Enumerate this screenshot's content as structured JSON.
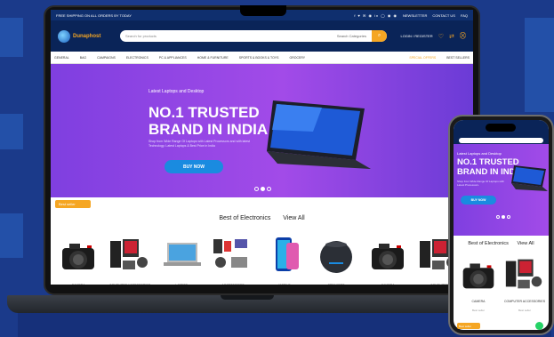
{
  "topbar": {
    "announcement": "FREE SHIPPING ON ALL ORDERS BY TODAY",
    "social": "f ♥ ✉ ◉ in ◯ ◉ ◉",
    "newsletter": "NEWSLETTER",
    "contact": "CONTACT US",
    "faq": "FAQ"
  },
  "header": {
    "logo_text": "Dunaphost",
    "search_placeholder": "Search for products",
    "search_category": "Search Categories",
    "account_label": "LOGIN / REGISTER"
  },
  "nav": {
    "items": [
      "GENERAL",
      "BAG",
      "CAMPAIGNS",
      "ELECTRONICS",
      "PC & APPLIANCES",
      "HOME & FURNITURE",
      "SPORTS & BOOKS & TOYS",
      "GROCERY"
    ],
    "highlight": "SPECIAL OFFERS",
    "last": "BEST SELLERS"
  },
  "hero": {
    "kicker": "Latest Laptops and Desktop",
    "title": "NO.1 TRUSTED BRAND IN INDIA",
    "description": "Shop from Wide Range Of Laptops with Latest Processors and with latest Technology. Latest Laptops & Best Price in India",
    "cta": "BUY NOW"
  },
  "products": {
    "badge": "Best seller",
    "section_title": "Best of Electronics",
    "view_all": "View All",
    "items": [
      {
        "label": "CAMERA",
        "icon": "camera-icon"
      },
      {
        "label": "COMPUTER ACCESSORIES",
        "icon": "accessories-icon"
      },
      {
        "label": "LAPTOP",
        "icon": "laptop-icon"
      },
      {
        "label": "ACCESSORIES",
        "icon": "gadgets-icon"
      },
      {
        "label": "MOBILE",
        "icon": "phone-icon"
      },
      {
        "label": "SPEAKERS",
        "icon": "speaker-icon"
      },
      {
        "label": "CAMERA",
        "icon": "camera-icon"
      },
      {
        "label": "COMPUTER",
        "icon": "accessories-icon"
      }
    ]
  },
  "phone": {
    "kicker": "Latest Laptops and Desktop",
    "title": "NO.1 TRUSTED BRAND IN INDIA",
    "description": "Shop from Wide Range Of Laptops with Latest Processors.",
    "cta": "BUY NOW",
    "section_title": "Best of Electronics",
    "view_all": "View All",
    "items": [
      {
        "label": "CAMERA",
        "sub": "Best seller"
      },
      {
        "label": "COMPUTER ACCESSORIES",
        "sub": "Best seller"
      }
    ],
    "badge": "Best seller"
  },
  "colors": {
    "background": "#1b3a8a",
    "navy": "#0a2458",
    "accent": "#f5a623",
    "hero_purple": "#a24be8",
    "cta_blue": "#1a8be0"
  }
}
